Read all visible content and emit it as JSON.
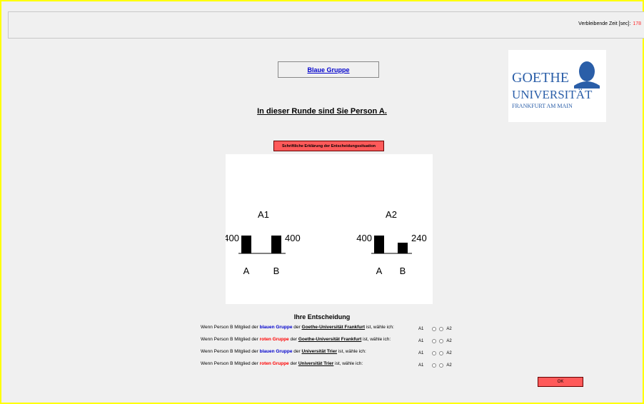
{
  "header": {
    "timer_label": "Verbleibende Zeit [sec]:",
    "timer_value": "178"
  },
  "group_label": "Blaue Gruppe",
  "person_title": "In dieser Runde sind Sie Person A.",
  "explain_button": "Schriftliche Erklärung der Entscheidungssituation",
  "logo": {
    "line1": "GOETHE",
    "line2": "UNIVERSITÄT",
    "line3": "FRANKFURT AM MAIN"
  },
  "options": [
    {
      "name": "A1",
      "a_value": 400,
      "b_value": 400,
      "a_label": "400",
      "b_label": "400",
      "cat_a": "A",
      "cat_b": "B"
    },
    {
      "name": "A2",
      "a_value": 400,
      "b_value": 240,
      "a_label": "400",
      "b_label": "240",
      "cat_a": "A",
      "cat_b": "B"
    }
  ],
  "decision_title": "Ihre Entscheidung",
  "rows": [
    {
      "pre": "Wenn Person B Mitglied der ",
      "group": "blauen Gruppe",
      "group_color": "blue",
      "mid": " der ",
      "uni": "Goethe-Universität Frankfurt",
      "post": " ist, wähle ich:"
    },
    {
      "pre": "Wenn Person B Mitglied der ",
      "group": "roten Gruppe",
      "group_color": "red",
      "mid": " der ",
      "uni": "Goethe-Universität Frankfurt",
      "post": " ist, wähle ich:"
    },
    {
      "pre": "Wenn Person B Mitglied der ",
      "group": "blauen Gruppe",
      "group_color": "blue",
      "mid": " der ",
      "uni": "Universität Trier",
      "post": " ist, wähle ich:"
    },
    {
      "pre": "Wenn Person B Mitglied der ",
      "group": "roten Gruppe",
      "group_color": "red",
      "mid": " der ",
      "uni": "Universität Trier",
      "post": " ist, wähle ich:"
    }
  ],
  "choice_left": "A1",
  "choice_right": "A2",
  "ok_button": "OK",
  "colors": {
    "frame": "#ffff00",
    "button": "#ff5a5a",
    "blue": "#0000cc",
    "red": "#ff0000",
    "logo_blue": "#2a5ea8"
  }
}
